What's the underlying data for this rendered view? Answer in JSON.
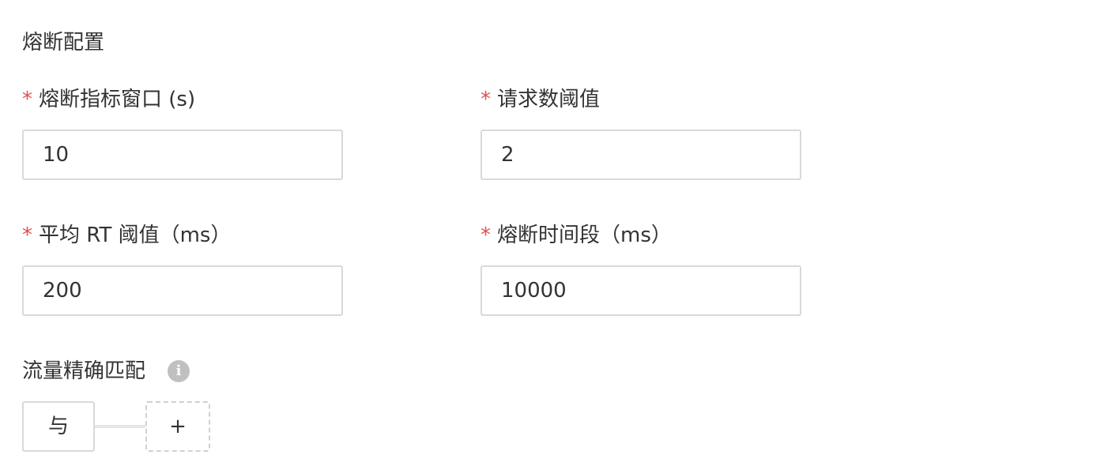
{
  "section": {
    "title": "熔断配置"
  },
  "fields": {
    "window": {
      "required": "*",
      "label": "熔断指标窗口 (s)",
      "value": "10"
    },
    "request_threshold": {
      "required": "*",
      "label": "请求数阈值",
      "value": "2"
    },
    "rt_threshold": {
      "required": "*",
      "label": "平均 RT 阈值（ms）",
      "value": "200"
    },
    "break_duration": {
      "required": "*",
      "label": "熔断时间段（ms）",
      "value": "10000"
    }
  },
  "traffic_match": {
    "title": "流量精确匹配",
    "info_icon": "info-icon",
    "info_glyph": "i",
    "operator_label": "与",
    "add_label": "+"
  }
}
